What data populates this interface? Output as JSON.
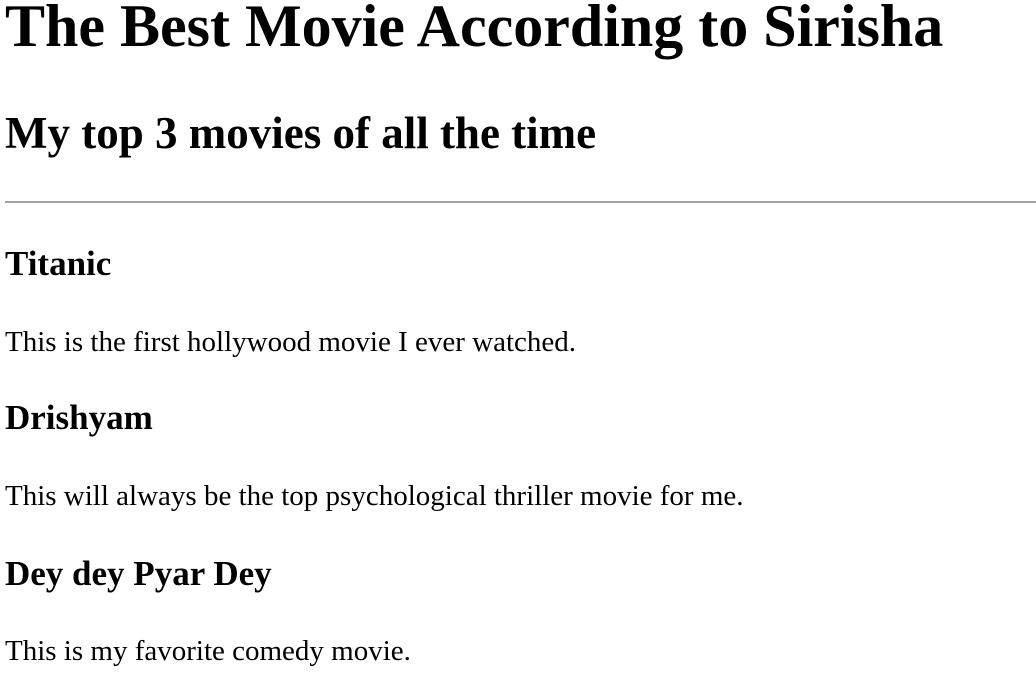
{
  "header": {
    "title": "The Best Movie According to Sirisha",
    "subtitle": "My top 3 movies of all the time"
  },
  "movies": [
    {
      "title": "Titanic",
      "description": "This is the first hollywood movie I ever watched."
    },
    {
      "title": "Drishyam",
      "description": "This will always be the top psychological thriller movie for me."
    },
    {
      "title": "Dey dey Pyar Dey",
      "description": "This is my favorite comedy movie."
    }
  ]
}
